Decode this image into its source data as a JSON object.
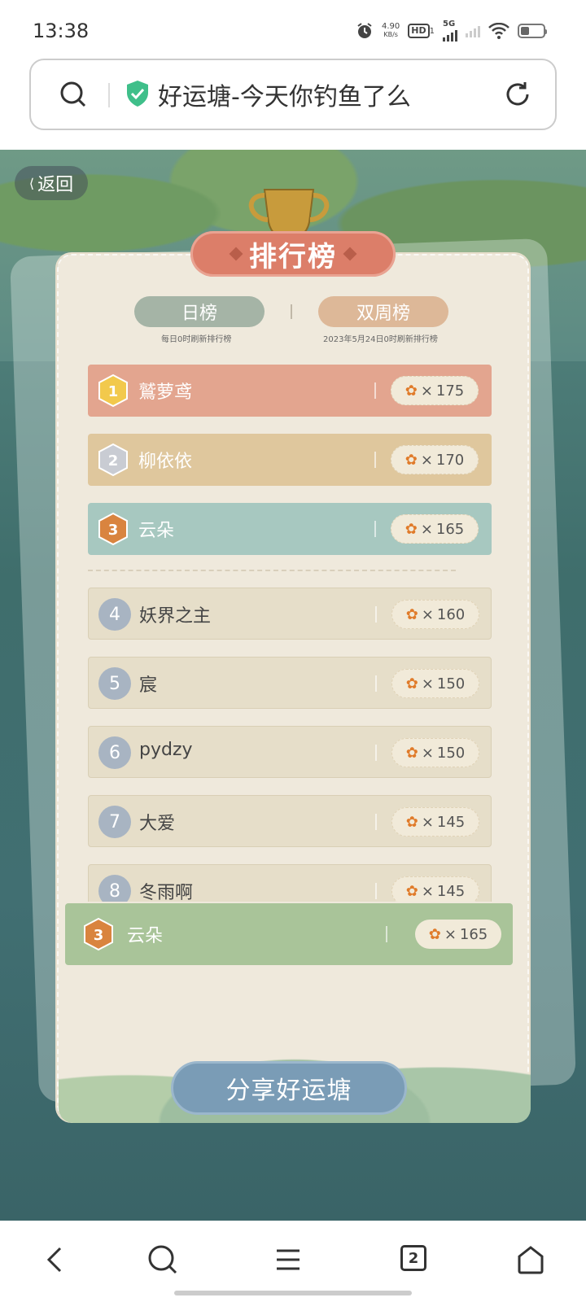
{
  "status_bar": {
    "time": "13:38",
    "net_speed_value": "4.90",
    "net_speed_unit": "KB/s",
    "hd_label": "HD",
    "hd_sub": "1",
    "network": "5G"
  },
  "address_bar": {
    "page_title": "好运塘-今天你钓鱼了么"
  },
  "game": {
    "back_label": "返回",
    "board_title": "排行榜",
    "tabs": [
      {
        "label": "日榜",
        "subtitle": "每日0时刷新排行榜"
      },
      {
        "label": "双周榜",
        "subtitle": "2023年5月24日0时刷新排行榜"
      }
    ],
    "ranking": [
      {
        "rank": "1",
        "name": "鷲萝鸢",
        "score": "175"
      },
      {
        "rank": "2",
        "name": "柳依依",
        "score": "170"
      },
      {
        "rank": "3",
        "name": "云朵",
        "score": "165"
      },
      {
        "rank": "4",
        "name": "妖界之主",
        "score": "160"
      },
      {
        "rank": "5",
        "name": "宸",
        "score": "150"
      },
      {
        "rank": "6",
        "name": "pydzy",
        "score": "150"
      },
      {
        "rank": "7",
        "name": "大爱",
        "score": "145"
      },
      {
        "rank": "8",
        "name": "冬雨啊",
        "score": "145"
      }
    ],
    "times_sign": "×",
    "my_rank": {
      "rank": "3",
      "name": "云朵",
      "score": "165"
    },
    "share_button": "分享好运塘"
  },
  "nav_bar": {
    "tab_count": "2"
  },
  "colors": {
    "rank1": "#e3a58f",
    "rank2": "#dfc79d",
    "rank3": "#a7c8c0",
    "my_rank": "#a9c499",
    "share": "#7a9cb6"
  }
}
